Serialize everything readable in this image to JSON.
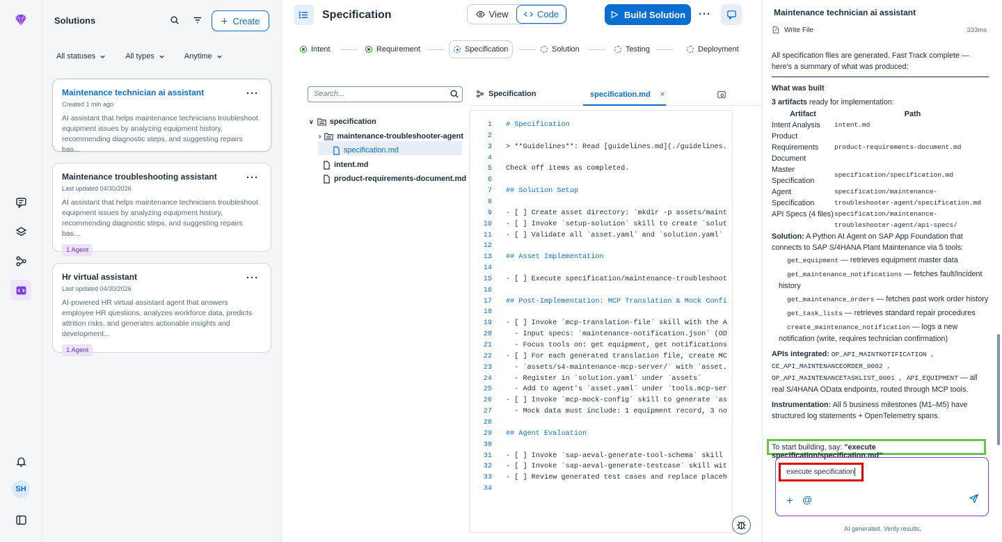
{
  "solutions": {
    "title": "Solutions",
    "create_label": "Create",
    "filters": [
      "All statuses",
      "All types",
      "Anytime"
    ],
    "cards": [
      {
        "title": "Maintenance technician ai assistant",
        "meta": "Created  1 min ago",
        "desc": "AI assistant that helps maintenance technicians troubleshoot equipment issues by analyzing equipment history, recommending diagnostic steps, and suggesting repairs bas...",
        "badge": ""
      },
      {
        "title": "Maintenance troubleshooting assistant",
        "meta": "Last updated  04/30/2026",
        "desc": "AI assistant that helps maintenance technicians troubleshoot equipment issues by analyzing equipment history, recommending diagnostic steps, and suggesting repairs bas...",
        "badge": "1 Agent"
      },
      {
        "title": "Hr virtual assistant",
        "meta": "Last updated  04/30/2026",
        "desc": "AI-powered HR virtual assistant agent that answers employee HR questions, analyzes workforce data, predicts attrition risks, and generates actionable insights and development...",
        "badge": "1 Agent"
      }
    ]
  },
  "user": {
    "initials": "SH"
  },
  "main": {
    "title": "Specification",
    "view_label": "View",
    "code_label": "Code",
    "build_label": "Build Solution",
    "steps": [
      "Intent",
      "Requirement",
      "Specification",
      "Solution",
      "Testing",
      "Deployment"
    ],
    "search_placeholder": "Search...",
    "panel_label": "Specification",
    "tab_file": "specification.md",
    "tab_close": "×",
    "tree": [
      "specification",
      "maintenance-troubleshooter-agent",
      "specification.md",
      "intent.md",
      "product-requirements-document.md"
    ],
    "code_lines": [
      "# Specification",
      "",
      "> **Guidelines**: Read [guidelines.md](./guidelines.",
      "",
      "Check off items as completed.",
      "",
      "## Solution Setup",
      "",
      "- [ ] Create asset directory: `mkdir -p assets/maint",
      "- [ ] Invoke `setup-solution` skill to create `solut",
      "- [ ] Validate all `asset.yaml` and `solution.yaml`",
      "",
      "## Asset Implementation",
      "",
      "- [ ] Execute specification/maintenance-troubleshoot",
      "",
      "## Post-Implementation: MCP Translation & Mock Confi",
      "",
      "- [ ] Invoke `mcp-translation-file` skill with the A",
      "  - Input specs: `maintenance-notification.json` (OD",
      "  - Focus tools on: get equipment, get notifications",
      "- [ ] For each generated translation file, create MC",
      "  - `assets/s4-maintenance-mcp-server/` with `asset.",
      "  - Register in `solution.yaml` under `assets`",
      "  - Add to agent's `asset.yaml` under `tools.mcp-ser",
      "- [ ] Invoke `mcp-mock-config` skill to generate `as",
      "  - Mock data must include: 1 equipment record, 3 no",
      "",
      "## Agent Evaluation",
      "",
      "- [ ] Invoke `sap-aeval-generate-tool-schema` skill",
      "- [ ] Invoke `sap-aeval-generate-testcase` skill wit",
      "- [ ] Review generated test cases and replace placeh",
      ""
    ]
  },
  "chat": {
    "title": "Maintenance technician ai assistant",
    "tool_label": "Write File",
    "tool_time": "333ms",
    "intro": "All specification files are generated. Fast Track complete — here's a summary of what was produced:",
    "built_heading": "What was built",
    "artifacts_count": "3 artifacts",
    "artifacts_suffix": " ready for implementation:",
    "table_head": [
      "Artifact",
      "Path"
    ],
    "table_rows": [
      [
        "Intent Analysis",
        "intent.md"
      ],
      [
        "Product Requirements Document",
        "product-requirements-document.md"
      ],
      [
        "Master Specification",
        "specification/specification.md"
      ],
      [
        "Agent Specification",
        "specification/maintenance-troubleshooter-agent/specification.md"
      ],
      [
        "API Specs (4 files)",
        "specification/maintenance-troubleshooter-agent/api-specs/"
      ]
    ],
    "solution_label": "Solution:",
    "solution_text": " A Python AI Agent on SAP App Foundation that connects to SAP S/4HANA Plant Maintenance via 5 tools:",
    "tools": [
      [
        "get_equipment",
        "— retrieves equipment master data"
      ],
      [
        "get_maintenance_notifications",
        "— fetches fault/incident history"
      ],
      [
        "get_maintenance_orders",
        "— fetches past work order history"
      ],
      [
        "get_task_lists",
        "— retrieves standard repair procedures"
      ],
      [
        "create_maintenance_notification",
        "— logs a new notification (write, requires technician confirmation)"
      ]
    ],
    "apis_label": "APIs integrated:",
    "apis": "OP_API_MAINTNOTIFICATION , CE_API_MAINTENANCEORDER_0002 , OP_API_MAINTENANCETASKLIST_0001 , API_EQUIPMENT",
    "apis_suffix": " — all real S/4HANA OData endpoints, routed through MCP tools.",
    "instr_label": "Instrumentation:",
    "instr_text": " All 5 business milestones (M1–M5) have structured log statements + OpenTelemetry spans.",
    "start_prefix": "To start building, say: ",
    "start_cmd": "\"execute specification/specification.md\"",
    "input_value": "execute specification",
    "footer": "AI generated. Verify results."
  }
}
